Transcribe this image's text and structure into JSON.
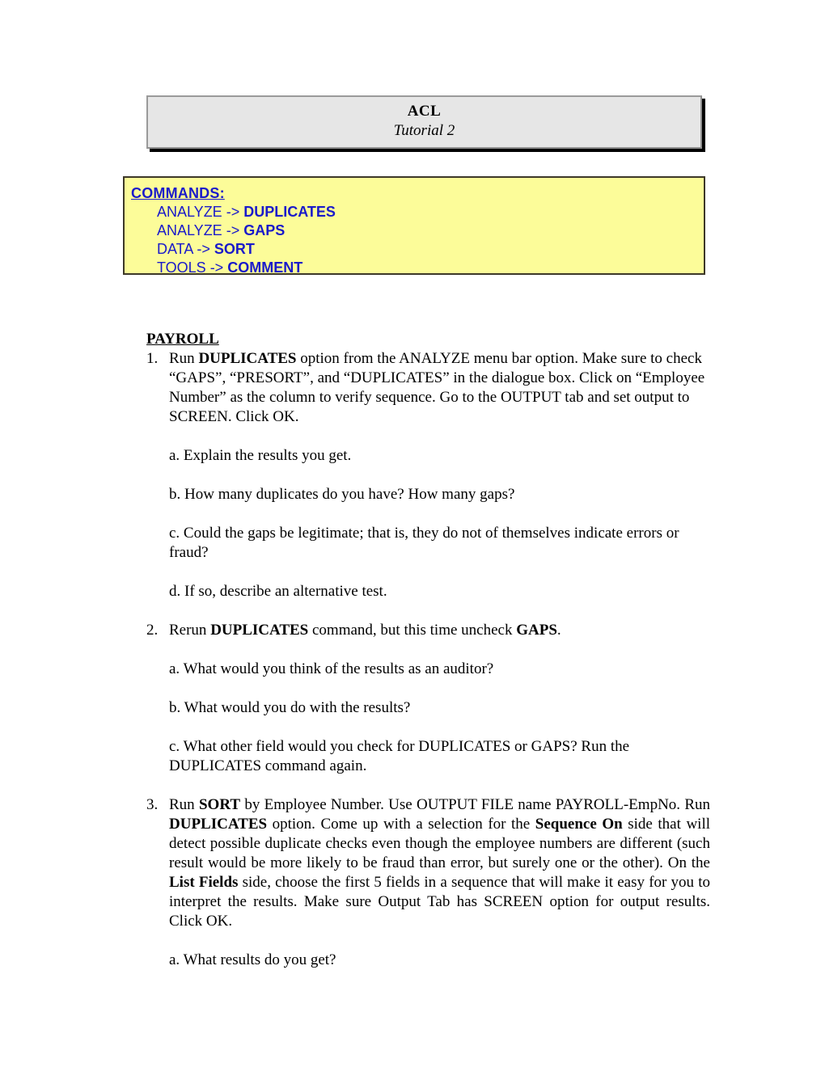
{
  "title_box": {
    "main": "ACL",
    "sub": "Tutorial 2"
  },
  "commands_box": {
    "heading": "COMMANDS:",
    "background_color": "#FCFC99",
    "text_color": "#1A1ACA",
    "lines": [
      {
        "prefix": "ANALYZE -> ",
        "command": "DUPLICATES"
      },
      {
        "prefix": "ANALYZE -> ",
        "command": "GAPS"
      },
      {
        "prefix": "DATA -> ",
        "command": "SORT"
      },
      {
        "prefix": "TOOLS -> ",
        "command": "COMMENT"
      }
    ]
  },
  "section": {
    "heading": "PAYROLL"
  },
  "items": [
    {
      "number": "1.",
      "text_parts": [
        {
          "text": "Run ",
          "bold": false
        },
        {
          "text": "DUPLICATES",
          "bold": true
        },
        {
          "text": " option from the ANALYZE menu bar option. Make sure to check “GAPS”, “PRESORT”, and “DUPLICATES” in the dialogue box. Click on “Employee Number” as the column to verify sequence. Go to the OUTPUT tab and set output to SCREEN. Click OK.",
          "bold": false
        }
      ],
      "justify": false,
      "subitems": [
        "a. Explain the results you get.",
        "b. How many duplicates do you have? How many gaps?",
        "c. Could the gaps be legitimate; that is, they do not of themselves indicate errors or fraud?",
        "d. If so, describe an alternative test."
      ]
    },
    {
      "number": "2.",
      "text_parts": [
        {
          "text": "Rerun ",
          "bold": false
        },
        {
          "text": "DUPLICATES",
          "bold": true
        },
        {
          "text": " command, but this time uncheck ",
          "bold": false
        },
        {
          "text": "GAPS",
          "bold": true
        },
        {
          "text": ".",
          "bold": false
        }
      ],
      "justify": false,
      "subitems": [
        "a. What would you think of the results as an auditor?",
        "b. What would you do with the results?",
        "c. What other field would you check for DUPLICATES or GAPS? Run the DUPLICATES command again."
      ]
    },
    {
      "number": "3.",
      "text_parts": [
        {
          "text": "Run ",
          "bold": false
        },
        {
          "text": "SORT",
          "bold": true
        },
        {
          "text": " by Employee Number. Use OUTPUT FILE name PAYROLL-EmpNo. Run ",
          "bold": false
        },
        {
          "text": "DUPLICATES",
          "bold": true
        },
        {
          "text": " option. Come up with a selection for the ",
          "bold": false
        },
        {
          "text": "Sequence On",
          "bold": true
        },
        {
          "text": " side that will detect possible duplicate checks even though the employee numbers are different (such result would be more likely to be fraud than error, but surely one or the other). On the ",
          "bold": false
        },
        {
          "text": "List Fields",
          "bold": true
        },
        {
          "text": " side, choose the first 5 fields in a sequence that will make it easy for you to interpret the results. Make sure Output Tab has SCREEN option for output results. Click OK.",
          "bold": false
        }
      ],
      "justify": true,
      "subitems": [
        "a. What results do you get?"
      ]
    }
  ]
}
